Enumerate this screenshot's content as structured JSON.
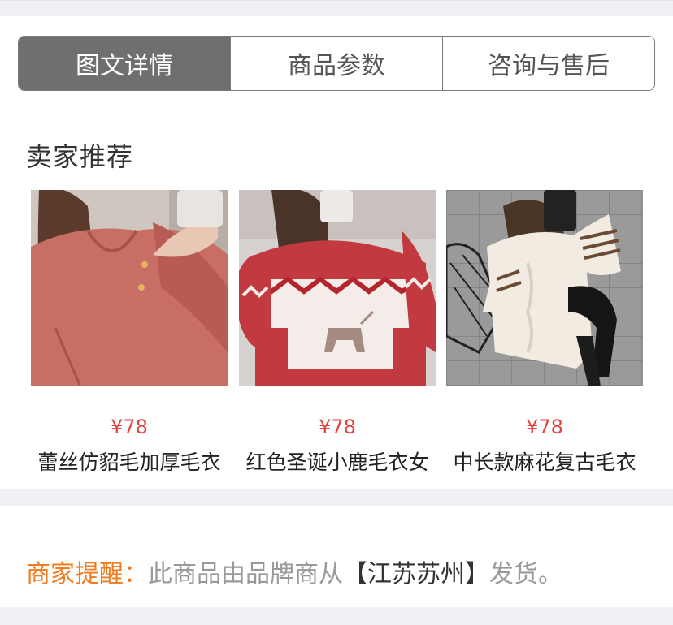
{
  "tabs": [
    {
      "label": "图文详情",
      "active": true
    },
    {
      "label": "商品参数",
      "active": false
    },
    {
      "label": "咨询与售后",
      "active": false
    }
  ],
  "section_title": "卖家推荐",
  "products": [
    {
      "price": "¥78",
      "name": "蕾丝仿貂毛加厚毛衣",
      "image": "pink-sweater-photo"
    },
    {
      "price": "¥78",
      "name": "红色圣诞小鹿毛衣女",
      "image": "red-christmas-deer-sweater-photo"
    },
    {
      "price": "¥78",
      "name": "中长款麻花复古毛衣",
      "image": "cream-cable-knit-sweater-photo"
    }
  ],
  "notice": {
    "label": "商家提醒：",
    "text_before": "此商品由品牌商从",
    "place": "【江苏苏州】",
    "text_after": "发货。"
  },
  "colors": {
    "tab_active_bg": "#6f6f6f",
    "price": "#e0453f",
    "notice_label": "#f07c1e",
    "page_bg": "#f1f1f5"
  }
}
